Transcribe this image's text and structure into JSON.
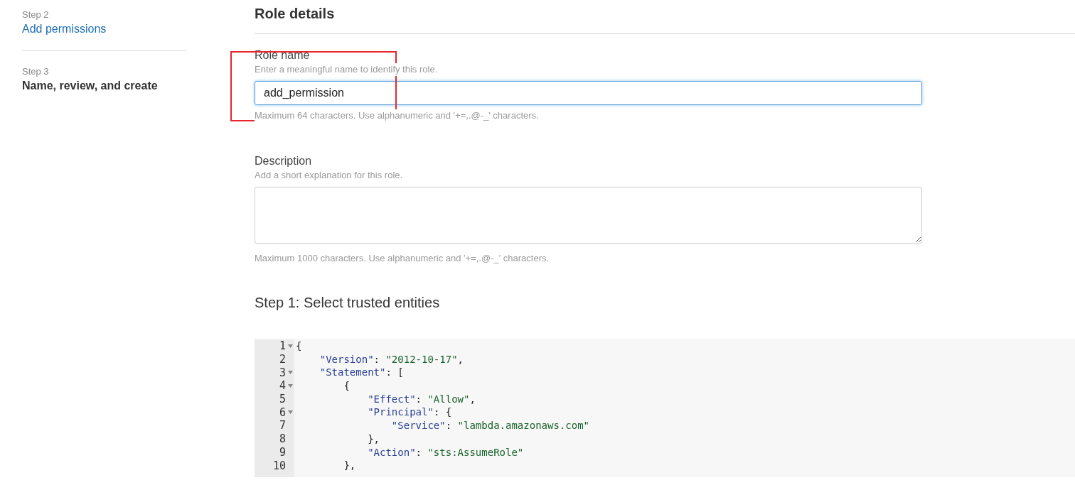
{
  "sidebar": {
    "steps": [
      {
        "label": "Step 2",
        "title": "Add permissions",
        "current": false
      },
      {
        "label": "Step 3",
        "title": "Name, review, and create",
        "current": true
      }
    ]
  },
  "main": {
    "title": "Role details",
    "fields": [
      {
        "kind": "input",
        "label": "Role name",
        "hint": "Enter a meaningful name to identify this role.",
        "value": "add_permission",
        "focused": true,
        "help": "Maximum 64 characters. Use alphanumeric and '+=,.@-_' characters."
      },
      {
        "kind": "textarea",
        "label": "Description",
        "hint": "Add a short explanation for this role.",
        "focused": false,
        "help": "Maximum 1000 characters. Use alphanumeric and '+=,.@-_' characters."
      }
    ],
    "section_title": "Step 1: Select trusted entities",
    "editor": {
      "lines": [
        {
          "number": "1",
          "foldable": true,
          "tokens": [
            {
              "kind": "punct",
              "text": "{"
            }
          ]
        },
        {
          "number": "2",
          "foldable": false,
          "tokens": [
            {
              "kind": "key",
              "text": "    \"Version\""
            },
            {
              "kind": "punct",
              "text": ": "
            },
            {
              "kind": "string",
              "text": "\"2012-10-17\""
            },
            {
              "kind": "punct",
              "text": ","
            }
          ]
        },
        {
          "number": "3",
          "foldable": true,
          "tokens": [
            {
              "kind": "key",
              "text": "    \"Statement\""
            },
            {
              "kind": "punct",
              "text": ": ["
            }
          ]
        },
        {
          "number": "4",
          "foldable": true,
          "tokens": [
            {
              "kind": "punct",
              "text": "        {"
            }
          ]
        },
        {
          "number": "5",
          "foldable": false,
          "tokens": [
            {
              "kind": "key",
              "text": "            \"Effect\""
            },
            {
              "kind": "punct",
              "text": ": "
            },
            {
              "kind": "string",
              "text": "\"Allow\""
            },
            {
              "kind": "punct",
              "text": ","
            }
          ]
        },
        {
          "number": "6",
          "foldable": true,
          "tokens": [
            {
              "kind": "key",
              "text": "            \"Principal\""
            },
            {
              "kind": "punct",
              "text": ": {"
            }
          ]
        },
        {
          "number": "7",
          "foldable": false,
          "tokens": [
            {
              "kind": "key",
              "text": "                \"Service\""
            },
            {
              "kind": "punct",
              "text": ": "
            },
            {
              "kind": "string",
              "text": "\"lambda.amazonaws.com\""
            }
          ]
        },
        {
          "number": "8",
          "foldable": false,
          "tokens": [
            {
              "kind": "punct",
              "text": "            },"
            }
          ]
        },
        {
          "number": "9",
          "foldable": false,
          "tokens": [
            {
              "kind": "key",
              "text": "            \"Action\""
            },
            {
              "kind": "punct",
              "text": ": "
            },
            {
              "kind": "string",
              "text": "\"sts:AssumeRole\""
            }
          ]
        },
        {
          "number": "10",
          "foldable": false,
          "tokens": [
            {
              "kind": "punct",
              "text": "        },"
            }
          ]
        }
      ]
    }
  }
}
